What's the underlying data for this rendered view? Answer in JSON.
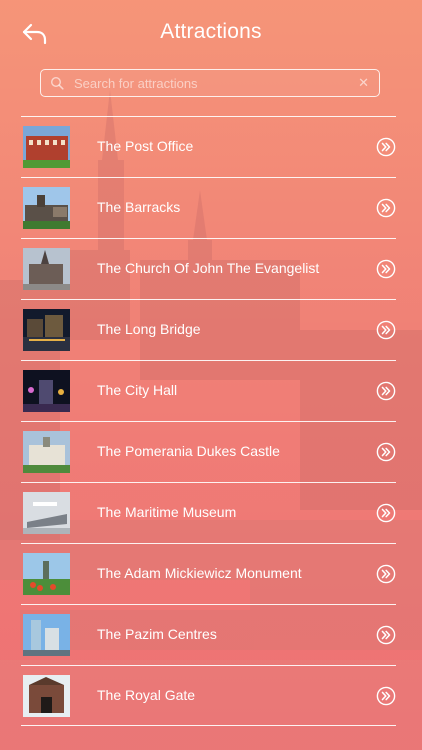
{
  "header": {
    "title": "Attractions",
    "back_icon": "back-arrow-icon"
  },
  "search": {
    "placeholder": "Search for attractions",
    "value": "",
    "clear_symbol": "✕"
  },
  "colors": {
    "bg_top": "#f6a07a",
    "bg_bottom": "#ee6e72",
    "text": "#ffffff"
  },
  "attractions": [
    {
      "label": "The Post Office",
      "icon": "post-office-thumbnail"
    },
    {
      "label": "The Barracks",
      "icon": "barracks-thumbnail"
    },
    {
      "label": "The Church Of John The Evangelist",
      "icon": "church-thumbnail"
    },
    {
      "label": "The Long Bridge",
      "icon": "long-bridge-thumbnail"
    },
    {
      "label": "The City Hall",
      "icon": "city-hall-thumbnail"
    },
    {
      "label": "The Pomerania Dukes Castle",
      "icon": "castle-thumbnail"
    },
    {
      "label": "The Maritime Museum",
      "icon": "museum-thumbnail"
    },
    {
      "label": "The Adam Mickiewicz Monument",
      "icon": "monument-thumbnail"
    },
    {
      "label": "The Pazim Centres",
      "icon": "pazim-thumbnail"
    },
    {
      "label": "The Royal Gate",
      "icon": "royal-gate-thumbnail"
    }
  ]
}
